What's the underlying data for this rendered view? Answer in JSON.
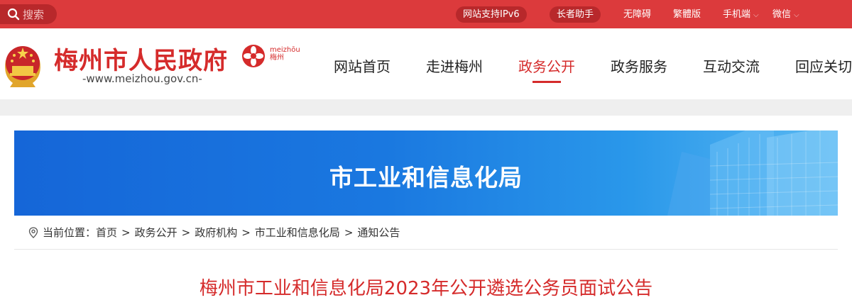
{
  "topbar": {
    "search_placeholder": "搜索",
    "ipv6_label": "网站支持IPv6",
    "elder_label": "长者助手",
    "accessibility_label": "无障碍",
    "traditional_label": "繁體版",
    "mobile_label": "手机端",
    "wechat_label": "微信"
  },
  "header": {
    "site_title": "梅州市人民政府",
    "site_url": "-www.meizhou.gov.cn-",
    "flower_label_top": "meizhōu",
    "flower_label_bottom": "梅州"
  },
  "nav": {
    "items": [
      {
        "label": "网站首页"
      },
      {
        "label": "走进梅州"
      },
      {
        "label": "政务公开"
      },
      {
        "label": "政务服务"
      },
      {
        "label": "互动交流"
      },
      {
        "label": "回应关切"
      }
    ],
    "active_index": 2
  },
  "banner": {
    "title": "市工业和信息化局"
  },
  "breadcrumb": {
    "prefix": "当前位置：",
    "items": [
      "首页",
      "政务公开",
      "政府机构",
      "市工业和信息化局",
      "通知公告"
    ],
    "separator": ">"
  },
  "article": {
    "title": "梅州市工业和信息化局2023年公开遴选公务员面试公告"
  },
  "colors": {
    "brand_red": "#dc3a3c",
    "title_red": "#d52b2b",
    "banner_blue": "#1a78e0"
  }
}
